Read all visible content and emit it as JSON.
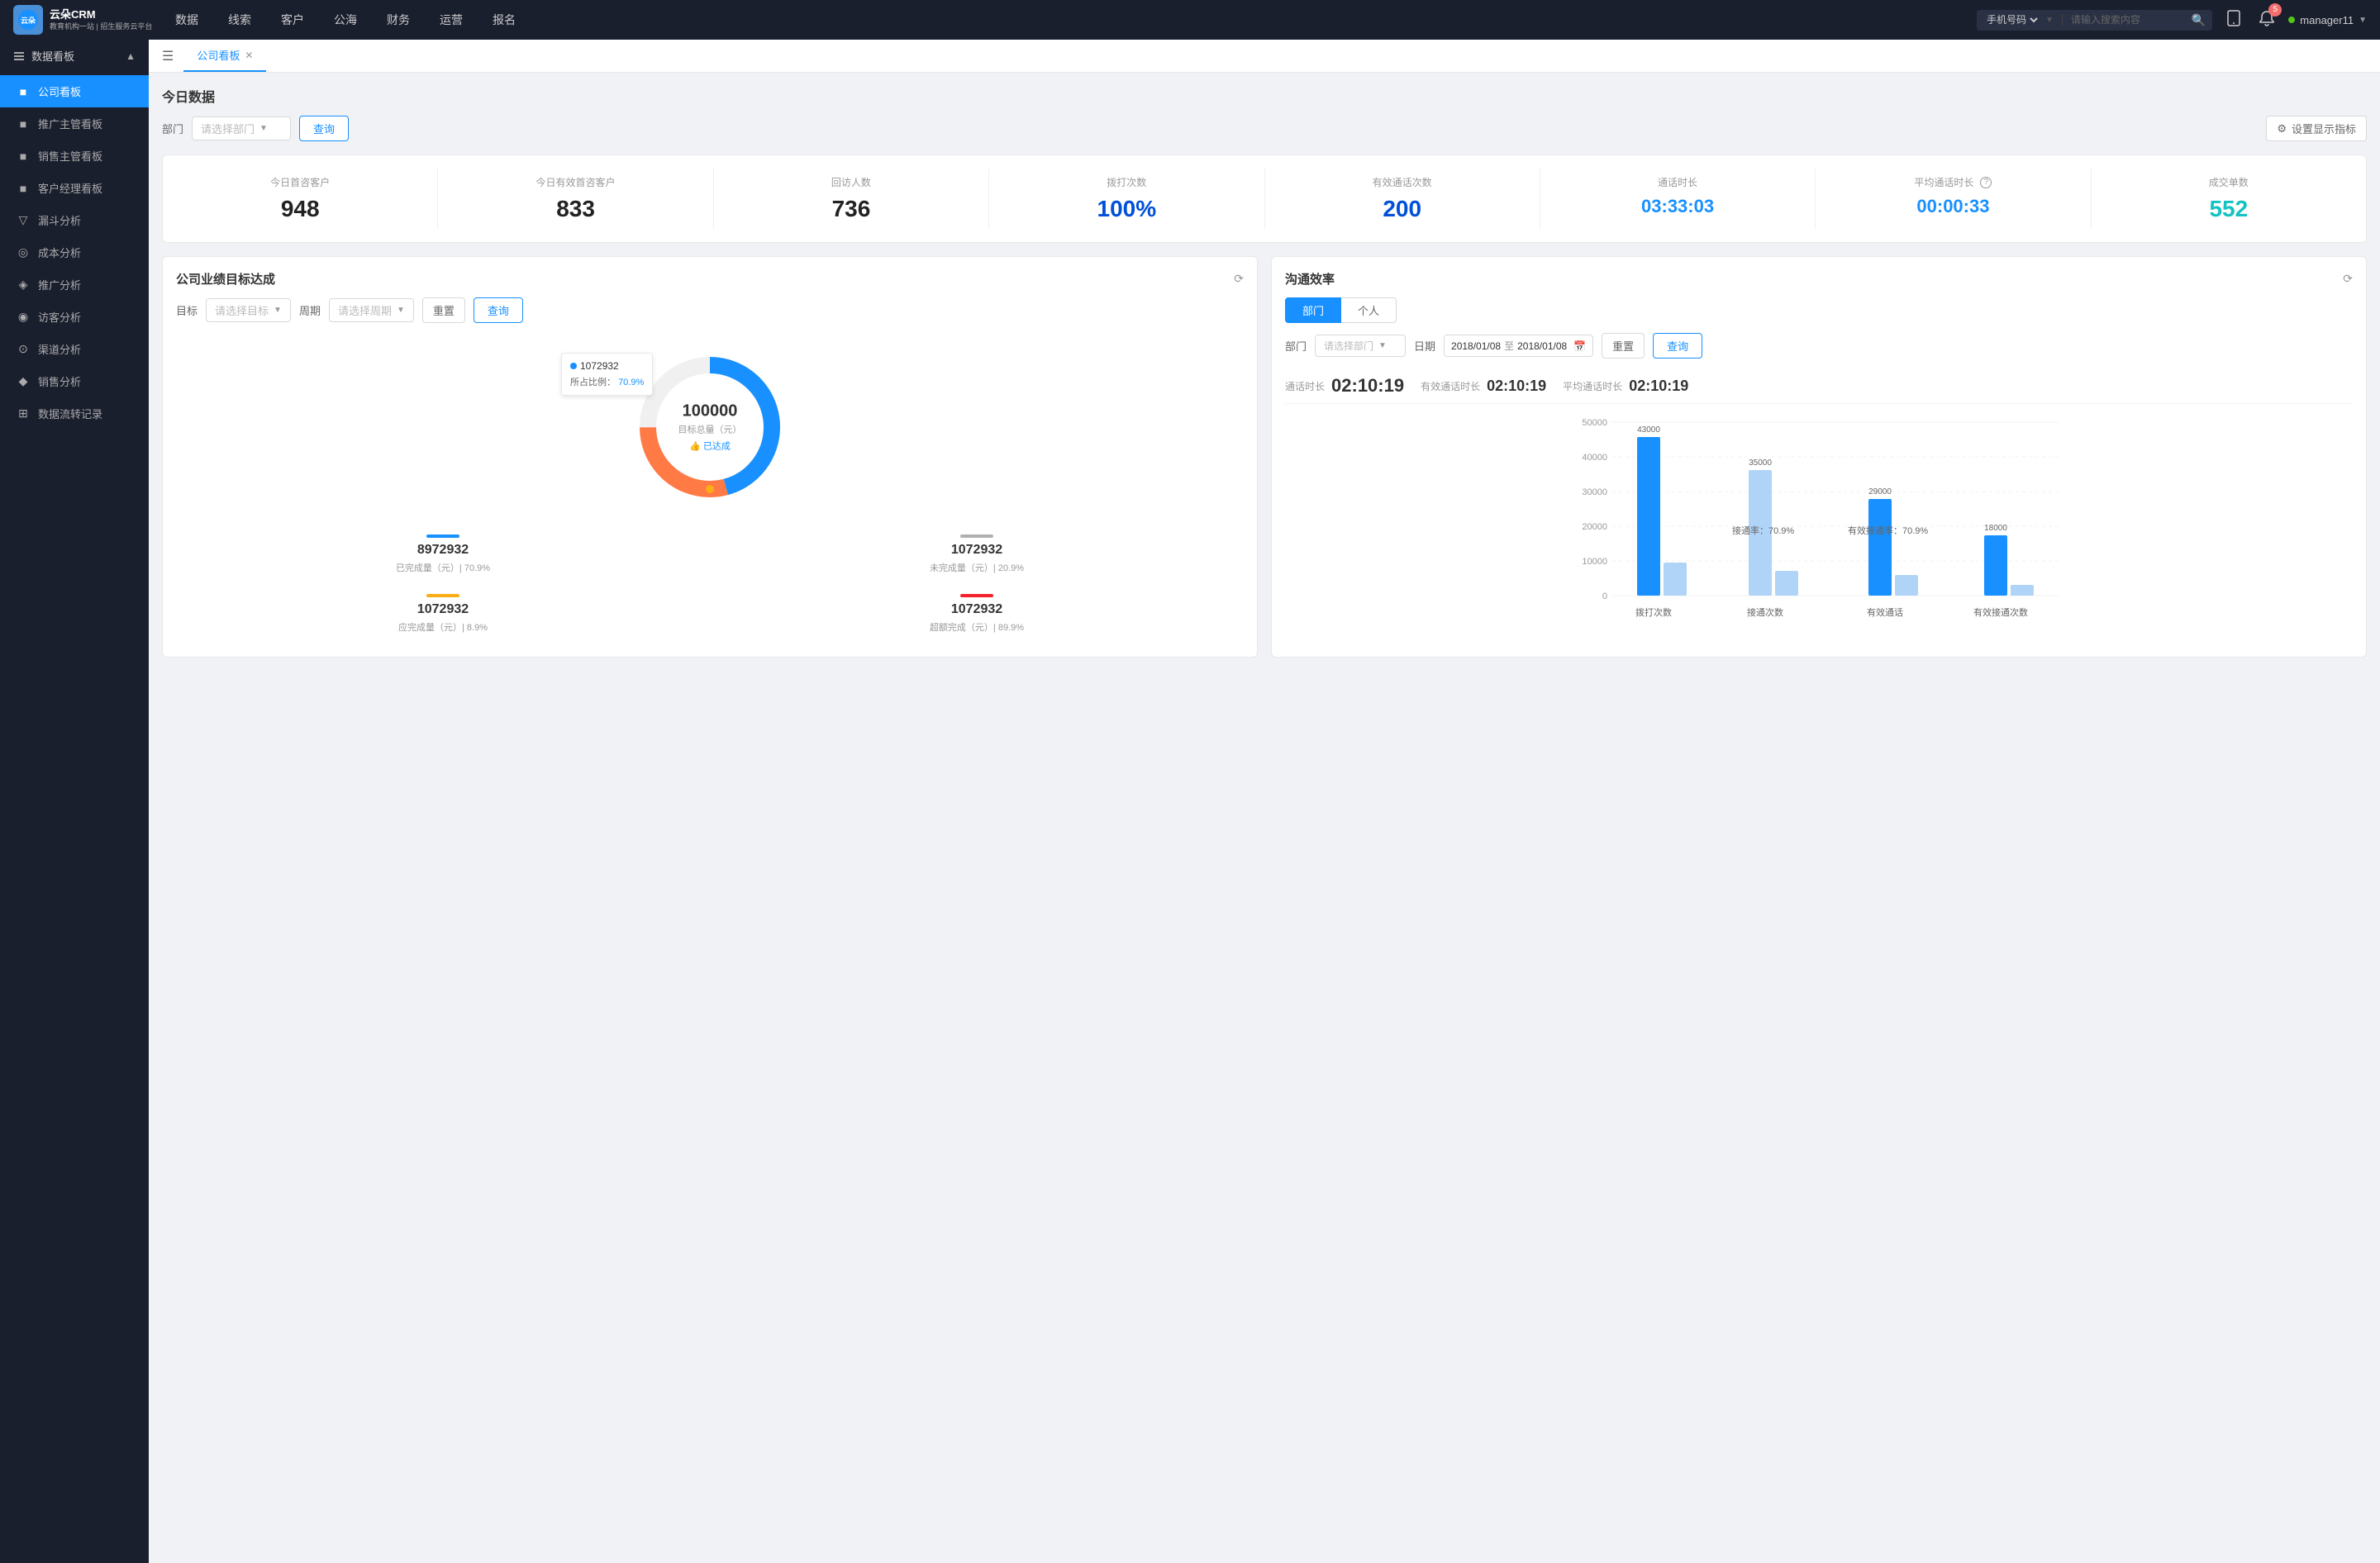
{
  "topnav": {
    "logo_text_line1": "云朵CRM",
    "logo_text_line2": "教育机构一站 | 招生服务云平台",
    "nav_items": [
      "数据",
      "线索",
      "客户",
      "公海",
      "财务",
      "运营",
      "报名"
    ],
    "search_placeholder": "请输入搜索内容",
    "search_select": "手机号码",
    "notification_count": "5",
    "username": "manager11"
  },
  "sidebar": {
    "group_title": "数据看板",
    "items": [
      {
        "label": "公司看板",
        "active": true
      },
      {
        "label": "推广主管看板",
        "active": false
      },
      {
        "label": "销售主管看板",
        "active": false
      },
      {
        "label": "客户经理看板",
        "active": false
      },
      {
        "label": "漏斗分析",
        "active": false
      },
      {
        "label": "成本分析",
        "active": false
      },
      {
        "label": "推广分析",
        "active": false
      },
      {
        "label": "访客分析",
        "active": false
      },
      {
        "label": "渠道分析",
        "active": false
      },
      {
        "label": "销售分析",
        "active": false
      },
      {
        "label": "数据流转记录",
        "active": false
      }
    ]
  },
  "tab_bar": {
    "tabs": [
      {
        "label": "公司看板",
        "active": true
      }
    ]
  },
  "today_section": {
    "title": "今日数据",
    "filter_label": "部门",
    "dept_placeholder": "请选择部门",
    "query_btn": "查询",
    "settings_btn": "设置显示指标",
    "stats": [
      {
        "label": "今日首咨客户",
        "value": "948",
        "color": "black"
      },
      {
        "label": "今日有效首咨客户",
        "value": "833",
        "color": "black"
      },
      {
        "label": "回访人数",
        "value": "736",
        "color": "black"
      },
      {
        "label": "拨打次数",
        "value": "100%",
        "color": "blue2"
      },
      {
        "label": "有效通话次数",
        "value": "200",
        "color": "blue2"
      },
      {
        "label": "通话时长",
        "value": "03:33:03",
        "color": "blue"
      },
      {
        "label": "平均通话时长",
        "value": "00:00:33",
        "color": "blue"
      },
      {
        "label": "成交单数",
        "value": "552",
        "color": "cyan"
      }
    ]
  },
  "goal_chart": {
    "title": "公司业绩目标达成",
    "target_label": "目标",
    "target_placeholder": "请选择目标",
    "period_label": "周期",
    "period_placeholder": "请选择周期",
    "reset_btn": "重置",
    "query_btn": "查询",
    "tooltip_value": "1072932",
    "tooltip_percent_label": "所占比例：",
    "tooltip_percent": "70.9%",
    "center_value": "100000",
    "center_label": "目标总量（元）",
    "center_sub": "👍 已达成",
    "stats": [
      {
        "line_color": "#1890ff",
        "value": "8972932",
        "label": "已完成量（元）| 70.9%"
      },
      {
        "line_color": "#b0b0b0",
        "value": "1072932",
        "label": "未完成量（元）| 20.9%"
      },
      {
        "line_color": "#faad14",
        "value": "1072932",
        "label": "应完成量（元）| 8.9%"
      },
      {
        "line_color": "#f5222d",
        "value": "1072932",
        "label": "超额完成（元）| 89.9%"
      }
    ]
  },
  "efficiency_chart": {
    "title": "沟通效率",
    "tabs": [
      "部门",
      "个人"
    ],
    "active_tab": "部门",
    "dept_label": "部门",
    "dept_placeholder": "请选择部门",
    "date_label": "日期",
    "date_start": "2018/01/08",
    "date_end": "2018/01/08",
    "reset_btn": "重置",
    "query_btn": "查询",
    "call_duration_label": "通话时长",
    "call_duration": "02:10:19",
    "effective_label": "有效通话时长",
    "effective_duration": "02:10:19",
    "avg_label": "平均通话时长",
    "avg_duration": "02:10:19",
    "y_labels": [
      "50000",
      "40000",
      "30000",
      "20000",
      "10000",
      "0"
    ],
    "bar_groups": [
      {
        "label": "拨打次数",
        "bars": [
          {
            "height_pct": 86,
            "value": "43000",
            "color": "blue"
          },
          {
            "height_pct": 0,
            "value": "",
            "color": "light"
          }
        ]
      },
      {
        "label": "接通次数",
        "bars": [
          {
            "height_pct": 70,
            "value": "35000",
            "color": "light"
          },
          {
            "height_pct": 0,
            "value": "",
            "color": "light"
          }
        ],
        "rate_label": "接通率：70.9%"
      },
      {
        "label": "有效通话",
        "bars": [
          {
            "height_pct": 58,
            "value": "29000",
            "color": "blue"
          },
          {
            "height_pct": 0,
            "value": "",
            "color": "light"
          }
        ],
        "rate_label": "有效接通率：70.9%"
      },
      {
        "label": "有效接通次数",
        "bars": [
          {
            "height_pct": 36,
            "value": "18000",
            "color": "blue"
          },
          {
            "height_pct": 0,
            "value": "",
            "color": "light"
          }
        ]
      }
    ]
  }
}
